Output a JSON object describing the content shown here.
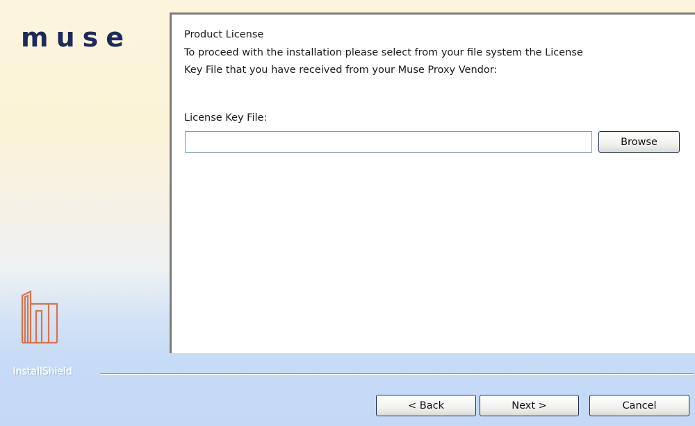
{
  "branding": {
    "logo_text": "muse",
    "logo_icon": "muse-building-icon",
    "installshield_label": "InstallShield"
  },
  "content": {
    "heading": "Product License",
    "instruction_line1": "To proceed with the installation please select from your file system the License",
    "instruction_line2": "Key File that you have received from your Muse Proxy Vendor:",
    "field_label": "License Key File:",
    "field_value": "",
    "browse_label": "Browse"
  },
  "footer": {
    "back_label": "< Back",
    "next_label": "Next >",
    "cancel_label": "Cancel"
  },
  "colors": {
    "logo_text": "#1d2a5c",
    "logo_icon": "#d8734c",
    "panel_border": "#7a7a7a",
    "input_border": "#7f9db9"
  }
}
